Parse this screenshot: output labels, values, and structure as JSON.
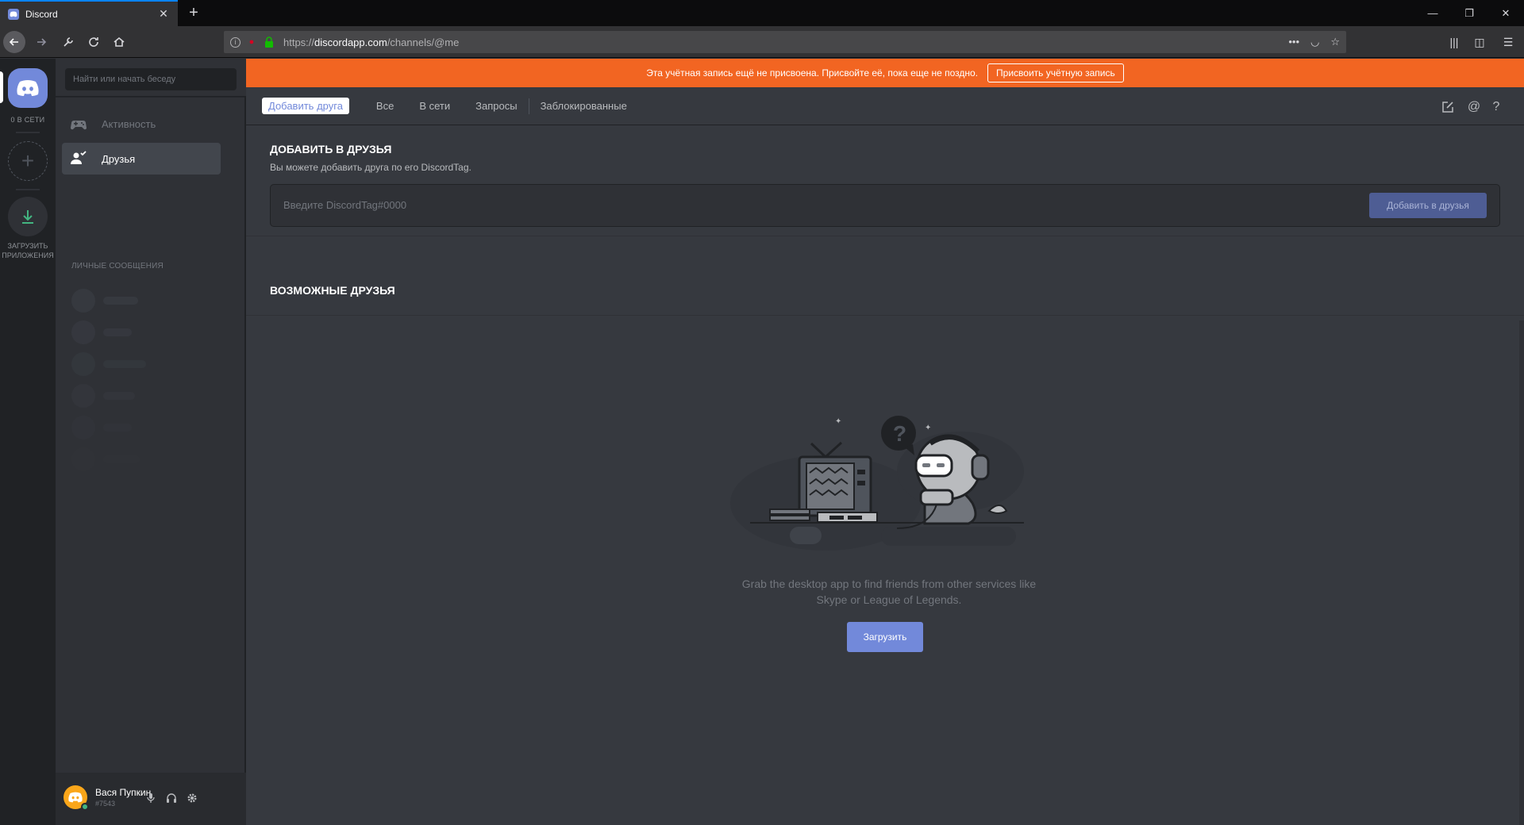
{
  "browser": {
    "tab_title": "Discord",
    "tab_close": "✕",
    "new_tab": "+",
    "url_prefix": "https://",
    "url_host": "discordapp.com",
    "url_path": "/channels/@me",
    "window_minimize": "—",
    "window_restore": "❐",
    "window_close": "✕"
  },
  "guilds": {
    "online_label": "0 В СЕТИ",
    "add_server": "+",
    "download_label": "ЗАГРУЗИТЬ ПРИЛОЖЕНИЯ"
  },
  "sidebar": {
    "search_placeholder": "Найти или начать беседу",
    "items": [
      {
        "label": "Активность",
        "icon": "gamepad-icon"
      },
      {
        "label": "Друзья",
        "icon": "friends-icon"
      }
    ],
    "dm_header": "ЛИЧНЫЕ СООБЩЕНИЯ"
  },
  "user": {
    "name": "Вася Пупкин",
    "tag": "#7543",
    "status_color": "#43b581"
  },
  "notice": {
    "text": "Эта учётная запись ещё не присвоена. Присвойте её, пока еще не поздно.",
    "button": "Присвоить учётную запись",
    "color": "#f26522"
  },
  "topnav": {
    "add_friend": "Добавить друга",
    "tabs": [
      "Все",
      "В сети",
      "Запросы",
      "Заблокированные"
    ]
  },
  "add_friend": {
    "title": "ДОБАВИТЬ В ДРУЗЬЯ",
    "description": "Вы можете добавить друга по его DiscordTag.",
    "placeholder": "Введите DiscordTag#0000",
    "button": "Добавить в друзья"
  },
  "suggestions": {
    "title": "ВОЗМОЖНЫЕ ДРУЗЬЯ",
    "empty_line1": "Grab the desktop app to find friends from other services like",
    "empty_line2": "Skype or League of Legends.",
    "download_button": "Загрузить"
  },
  "colors": {
    "accent": "#7289da",
    "background": "#36393f",
    "sidebar": "#2f3136",
    "guilds": "#202225"
  }
}
